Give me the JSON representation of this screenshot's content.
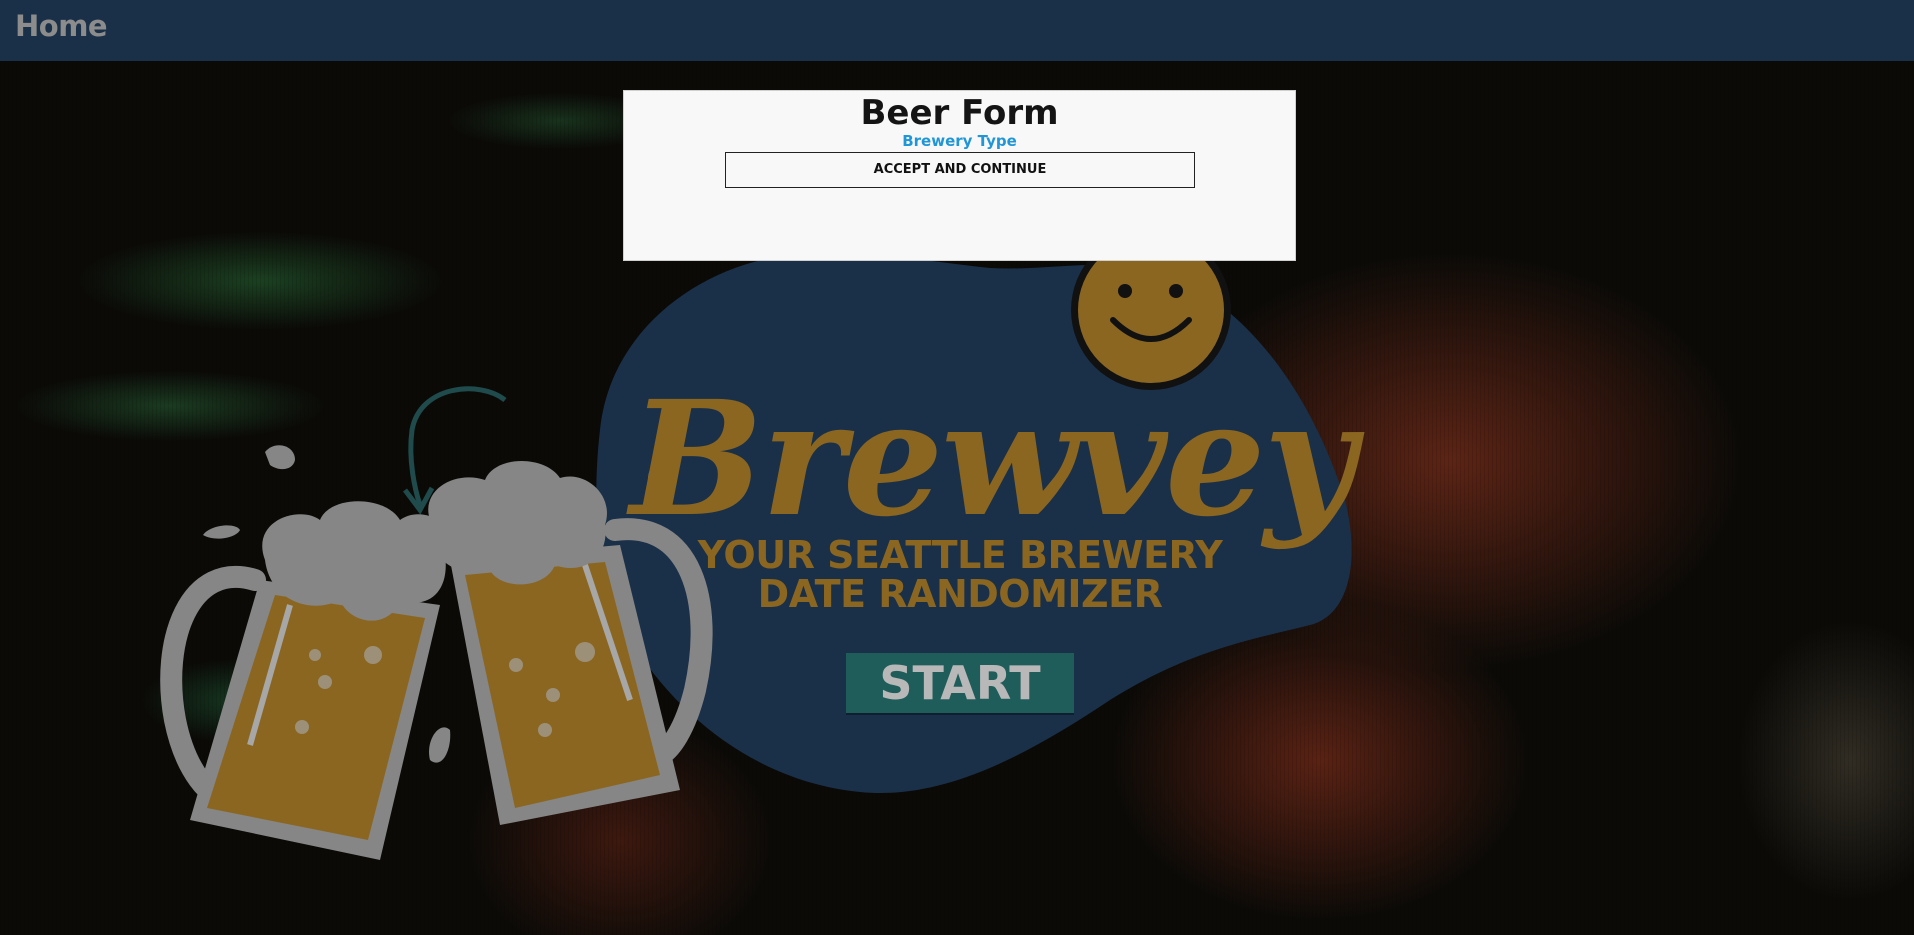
{
  "nav": {
    "home_label": "Home"
  },
  "hero": {
    "title": "Brewvey",
    "tagline": "YOUR SEATTLE BREWERY DATE RANDOMIZER",
    "start_label": "START",
    "icons": [
      "beer-mugs-cheers-icon",
      "smiley-face-icon"
    ]
  },
  "modal": {
    "title": "Beer Form",
    "subtitle": "Brewery Type",
    "accept_label": "ACCEPT AND CONTINUE"
  },
  "colors": {
    "nav_bg": "#1a3049",
    "blob": "#1a3049",
    "brand_gold": "#8b6620",
    "start_bg": "#1f5d5a",
    "link_blue": "#2196d6",
    "modal_bg": "#f8f8f8"
  }
}
